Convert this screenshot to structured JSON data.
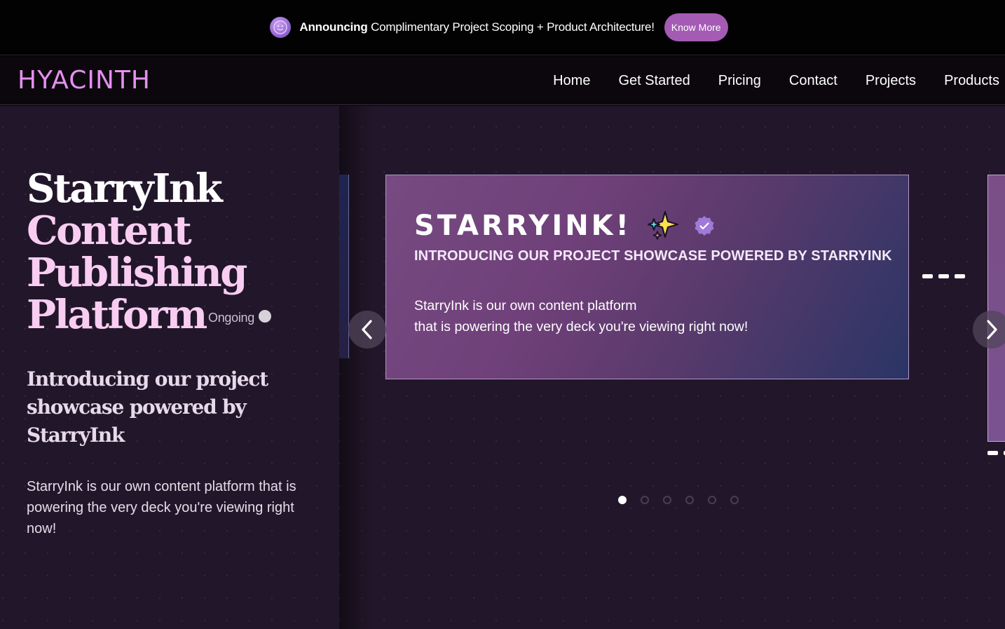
{
  "announcement": {
    "lead": "Announcing",
    "text": "Complimentary Project Scoping + Product Architecture!",
    "button_label": "Know More",
    "avatar_icon": "smiley-face-icon"
  },
  "nav": {
    "logo": "HYACINTH",
    "links": [
      "Home",
      "Get Started",
      "Pricing",
      "Contact",
      "Projects",
      "Products"
    ]
  },
  "hero": {
    "title_line1": "StarryInk",
    "title_line2": "Content",
    "title_line3": "Publishing",
    "title_line4": "Platform",
    "status": "Ongoing",
    "subtitle": "Introducing our project showcase powered by StarryInk",
    "description": "StarryInk is our own content platform that is powering the very deck you're viewing right now!"
  },
  "carousel": {
    "card": {
      "title": "STARRYINK!",
      "title_icons": [
        "sparkles-icon",
        "verified-badge-icon"
      ],
      "subtitle": "INTRODUCING OUR PROJECT SHOWCASE POWERED BY STARRYINK",
      "desc_line1": "StarryInk is our own content platform",
      "desc_line2": "that is powering the very deck you're viewing right now!"
    },
    "slide_count": 6,
    "active_slide": 1
  },
  "colors": {
    "logo": "#e58ff0",
    "know_more_button": "#a35bb4",
    "hero_title": "#f9cdf2",
    "background": "#22172a"
  }
}
